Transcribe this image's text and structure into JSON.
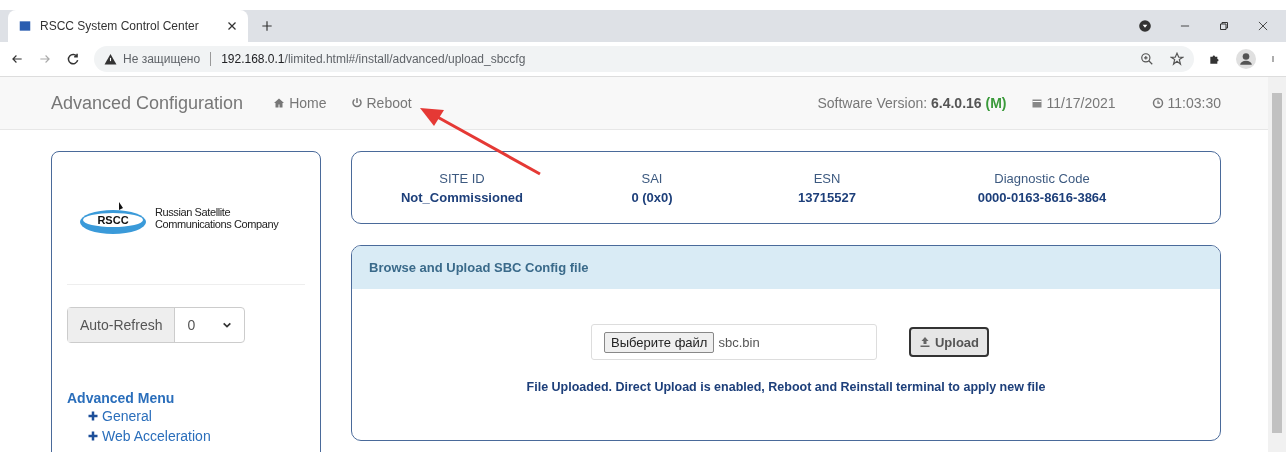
{
  "browser": {
    "tab_title": "RSCC System Control Center",
    "security": "Не защищено",
    "url_host": "192.168.0.1",
    "url_path": "/limited.html#/install/advanced/upload_sbccfg"
  },
  "header": {
    "title": "Advanced Configuration",
    "nav": [
      {
        "label": "Home",
        "kind": "home"
      },
      {
        "label": "Reboot",
        "kind": "power"
      }
    ],
    "version_label": "Software Version:",
    "version": "6.4.0.16",
    "version_mode": "(M)",
    "date": "11/17/2021",
    "time": "11:03:30"
  },
  "sidebar": {
    "logo_mark": "RSCC",
    "logo_lines": [
      "Russian Satellite",
      "Communications Company"
    ],
    "auto_refresh": {
      "label": "Auto-Refresh",
      "value": "0"
    },
    "menu": {
      "title": "Advanced Menu",
      "items": [
        "General",
        "Web Acceleration"
      ]
    }
  },
  "info": [
    {
      "label": "SITE ID",
      "value": "Not_Commissioned"
    },
    {
      "label": "SAI",
      "value": "0 (0x0)"
    },
    {
      "label": "ESN",
      "value": "13715527"
    },
    {
      "label": "Diagnostic Code",
      "value": "0000-0163-8616-3864"
    }
  ],
  "upload": {
    "title": "Browse and Upload SBC Config file",
    "choose_button": "Выберите файл",
    "file_name": "sbc.bin",
    "upload_button": "Upload",
    "message": "File Uploaded. Direct Upload is enabled, Reboot and Reinstall terminal to apply new file"
  }
}
